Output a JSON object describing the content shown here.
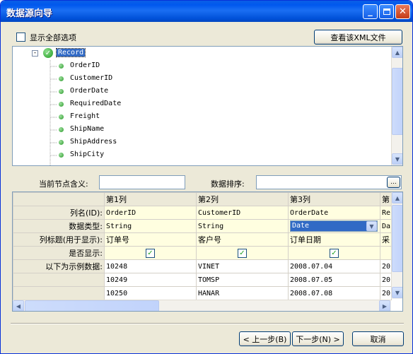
{
  "window": {
    "title": "数据源向导"
  },
  "options": {
    "show_all_label": "显示全部选项",
    "view_xml_label": "查看该XML文件"
  },
  "tree": {
    "root": "Record",
    "nodes": [
      "OrderID",
      "CustomerID",
      "OrderDate",
      "RequiredDate",
      "Freight",
      "ShipName",
      "ShipAddress",
      "ShipCity"
    ]
  },
  "node_meaning": {
    "label": "当前节点含义:",
    "value": ""
  },
  "data_sort": {
    "label": "数据排序:",
    "value": "",
    "button_label": "..."
  },
  "grid": {
    "columns": [
      "第1列",
      "第2列",
      "第3列",
      "第"
    ],
    "row_labels": [
      "列名(ID):",
      "数据类型:",
      "列标题(用于显示):",
      "是否显示:",
      "以下为示例数据:",
      "",
      ""
    ],
    "rows": [
      [
        "OrderID",
        "CustomerID",
        "OrderDate",
        "Re"
      ],
      [
        "String",
        "String",
        "Date",
        "Da"
      ],
      [
        "订单号",
        "客户号",
        "订单日期",
        "采"
      ],
      [
        "",
        "",
        "",
        ""
      ],
      [
        "10248",
        "VINET",
        "2008.07.04",
        "20"
      ],
      [
        "10249",
        "TOMSP",
        "2008.07.05",
        "20"
      ],
      [
        "10250",
        "HANAR",
        "2008.07.08",
        "20"
      ]
    ]
  },
  "buttons": {
    "prev": "< 上一步(B)",
    "next": "下一步(N) >",
    "cancel": "取消"
  }
}
